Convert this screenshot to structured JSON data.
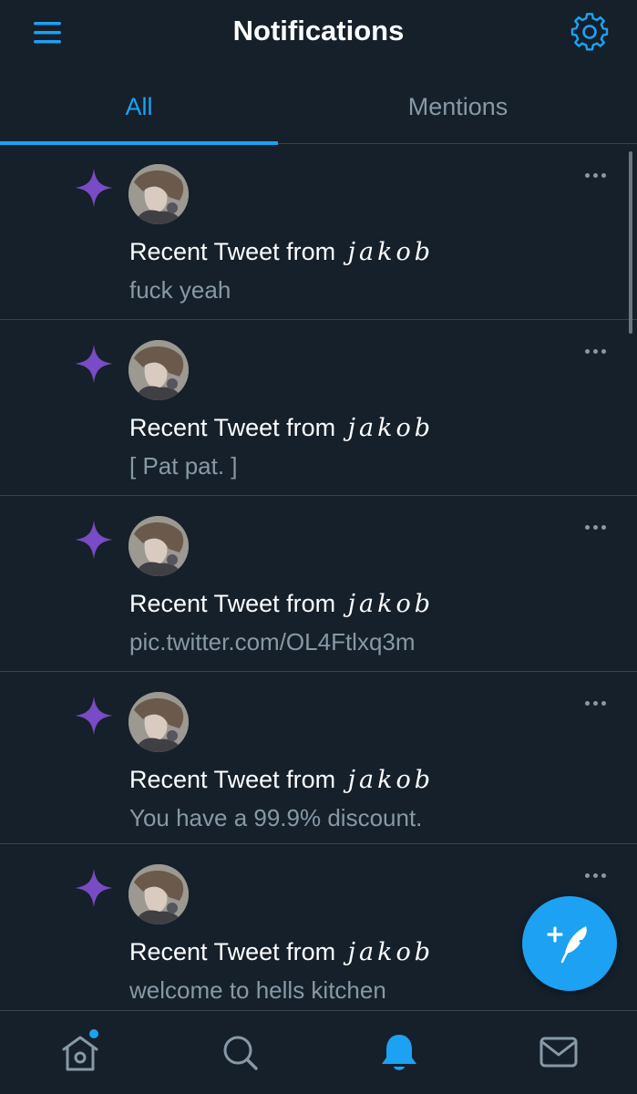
{
  "header": {
    "title": "Notifications",
    "menu_icon": "hamburger-menu-icon",
    "settings_icon": "gear-icon"
  },
  "tabs": [
    {
      "label": "All",
      "active": true
    },
    {
      "label": "Mentions",
      "active": false
    }
  ],
  "notifications": [
    {
      "prefix": "Recent Tweet from",
      "author": "jakob",
      "text": "fuck yeah"
    },
    {
      "prefix": "Recent Tweet from",
      "author": "jakob",
      "text": "[ Pat pat. ]"
    },
    {
      "prefix": "Recent Tweet from",
      "author": "jakob",
      "text": "pic.twitter.com/OL4Ftlxq3m"
    },
    {
      "prefix": "Recent Tweet from",
      "author": "jakob",
      "text": "You have a 99.9% discount."
    },
    {
      "prefix": "Recent Tweet from",
      "author": "jakob",
      "text": "welcome to hells kitchen"
    }
  ],
  "bottom_nav": [
    {
      "icon": "home-icon",
      "has_badge": true
    },
    {
      "icon": "search-icon"
    },
    {
      "icon": "bell-icon",
      "active": true
    },
    {
      "icon": "mail-icon"
    }
  ],
  "compose_icon": "compose-tweet-icon",
  "colors": {
    "background": "#15202b",
    "accent": "#1da1f2",
    "secondary_text": "#8899a6",
    "divider": "#38444d",
    "sparkle": "#794bc4"
  }
}
